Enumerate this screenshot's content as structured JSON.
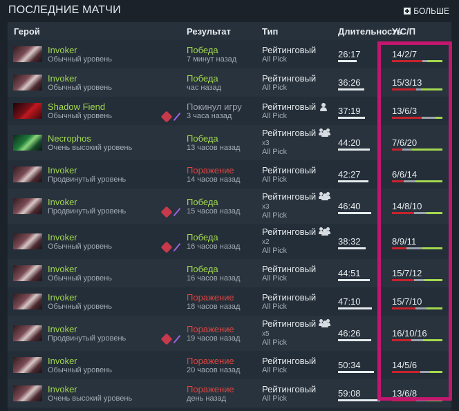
{
  "header": {
    "title": "ПОСЛЕДНИЕ МАТЧИ",
    "more_label": "БОЛЬШЕ"
  },
  "columns": {
    "hero": "Герой",
    "result": "Результат",
    "type": "Тип",
    "duration": "Длительность",
    "kda": "У/С/П"
  },
  "colors": {
    "win": "#a3d94f",
    "loss": "#e0443e",
    "abandon": "#9ba3ab",
    "highlight": "#c2176f"
  },
  "matches": [
    {
      "hero": "Invoker",
      "avatar": "invoker",
      "skill": "Обычный уровень",
      "result": "Победа",
      "result_kind": "win",
      "time": "7 минут назад",
      "type": "Рейтинговый",
      "mode": "All Pick",
      "party": "",
      "party_icon": "",
      "duration": "26:17",
      "kda": "14/2/7",
      "icons": false
    },
    {
      "hero": "Invoker",
      "avatar": "invoker",
      "skill": "Обычный уровень",
      "result": "Победа",
      "result_kind": "win",
      "time": "час назад",
      "type": "Рейтинговый",
      "mode": "All Pick",
      "party": "",
      "party_icon": "",
      "duration": "36:26",
      "kda": "15/3/13",
      "icons": false
    },
    {
      "hero": "Shadow Fiend",
      "avatar": "sf",
      "skill": "Обычный уровень",
      "result": "Покинул игру",
      "result_kind": "abandon",
      "time": "3 часа назад",
      "type": "Рейтинговый",
      "mode": "All Pick",
      "party": "",
      "party_icon": "person",
      "duration": "37:19",
      "kda": "13/6/3",
      "icons": true
    },
    {
      "hero": "Necrophos",
      "avatar": "necro",
      "skill": "Очень высокий уровень",
      "result": "Победа",
      "result_kind": "win",
      "time": "13 часов назад",
      "type": "Рейтинговый",
      "mode": "All Pick",
      "party": "x3",
      "party_icon": "group",
      "duration": "44:20",
      "kda": "7/6/20",
      "icons": false
    },
    {
      "hero": "Invoker",
      "avatar": "invoker",
      "skill": "Продвинутый уровень",
      "result": "Поражение",
      "result_kind": "loss",
      "time": "14 часов назад",
      "type": "Рейтинговый",
      "mode": "All Pick",
      "party": "",
      "party_icon": "",
      "duration": "42:27",
      "kda": "6/6/14",
      "icons": false
    },
    {
      "hero": "Invoker",
      "avatar": "invoker",
      "skill": "Продвинутый уровень",
      "result": "Победа",
      "result_kind": "win",
      "time": "15 часов назад",
      "type": "Рейтинговый",
      "mode": "All Pick",
      "party": "x3",
      "party_icon": "group",
      "duration": "46:40",
      "kda": "14/8/10",
      "icons": true
    },
    {
      "hero": "Invoker",
      "avatar": "invoker",
      "skill": "Обычный уровень",
      "result": "Победа",
      "result_kind": "win",
      "time": "16 часов назад",
      "type": "Рейтинговый",
      "mode": "All Pick",
      "party": "x2",
      "party_icon": "group",
      "duration": "38:32",
      "kda": "8/9/11",
      "icons": true
    },
    {
      "hero": "Invoker",
      "avatar": "invoker",
      "skill": "Обычный уровень",
      "result": "Победа",
      "result_kind": "win",
      "time": "16 часов назад",
      "type": "Рейтинговый",
      "mode": "All Pick",
      "party": "",
      "party_icon": "",
      "duration": "44:51",
      "kda": "15/7/12",
      "icons": false
    },
    {
      "hero": "Invoker",
      "avatar": "invoker",
      "skill": "Обычный уровень",
      "result": "Поражение",
      "result_kind": "loss",
      "time": "18 часов назад",
      "type": "Рейтинговый",
      "mode": "All Pick",
      "party": "",
      "party_icon": "",
      "duration": "47:10",
      "kda": "15/7/10",
      "icons": false
    },
    {
      "hero": "Invoker",
      "avatar": "invoker",
      "skill": "Продвинутый уровень",
      "result": "Поражение",
      "result_kind": "loss",
      "time": "19 часов назад",
      "type": "Рейтинговый",
      "mode": "All Pick",
      "party": "x5",
      "party_icon": "group",
      "duration": "46:26",
      "kda": "16/10/16",
      "icons": true
    },
    {
      "hero": "Invoker",
      "avatar": "invoker",
      "skill": "Обычный уровень",
      "result": "Поражение",
      "result_kind": "loss",
      "time": "20 часов назад",
      "type": "Рейтинговый",
      "mode": "All Pick",
      "party": "",
      "party_icon": "",
      "duration": "50:34",
      "kda": "14/5/6",
      "icons": false
    },
    {
      "hero": "Invoker",
      "avatar": "invoker",
      "skill": "Очень высокий уровень",
      "result": "Поражение",
      "result_kind": "loss",
      "time": "день назад",
      "type": "Рейтинговый",
      "mode": "All Pick",
      "party": "",
      "party_icon": "",
      "duration": "59:08",
      "kda": "13/6/8",
      "icons": false
    }
  ]
}
